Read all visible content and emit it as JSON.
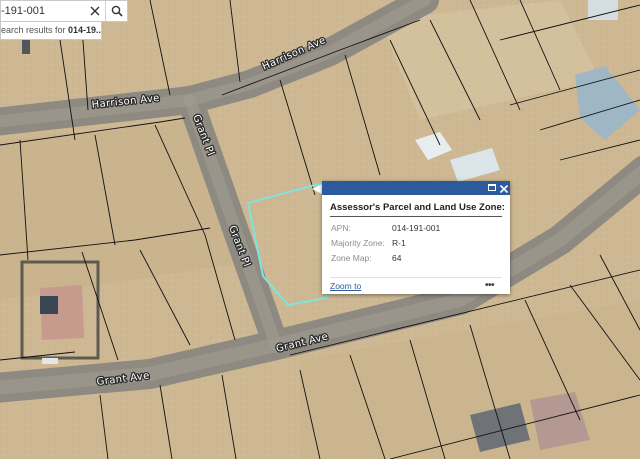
{
  "search": {
    "value": "-191-001",
    "suggestion_prefix": "earch results for ",
    "suggestion_term": "014-19..."
  },
  "streets": {
    "harrison_upper": "Harrison Ave",
    "harrison_lower": "Harrison Ave",
    "grant_pl_upper": "Grant Pl",
    "grant_pl_lower": "Grant Pl",
    "grant_ave_right": "Grant Ave",
    "grant_ave_left": "Grant Ave"
  },
  "popup": {
    "title": "Assessor's Parcel and Land Use Zone:",
    "fields": [
      {
        "label": "APN:",
        "value": "014-191-001"
      },
      {
        "label": "Majority Zone:",
        "value": "R-1"
      },
      {
        "label": "Zone Map:",
        "value": "64"
      }
    ],
    "zoom_label": "Zoom to",
    "more_label": "•••"
  },
  "colors": {
    "header": "#2c5a9c",
    "selection": "#7fe3df",
    "parcel_line": "#111111",
    "ground": "#cdb893"
  },
  "icons": {
    "clear": "close-icon",
    "search": "search-icon",
    "maximize": "maximize-icon",
    "close": "close-icon",
    "more": "ellipsis-icon"
  }
}
